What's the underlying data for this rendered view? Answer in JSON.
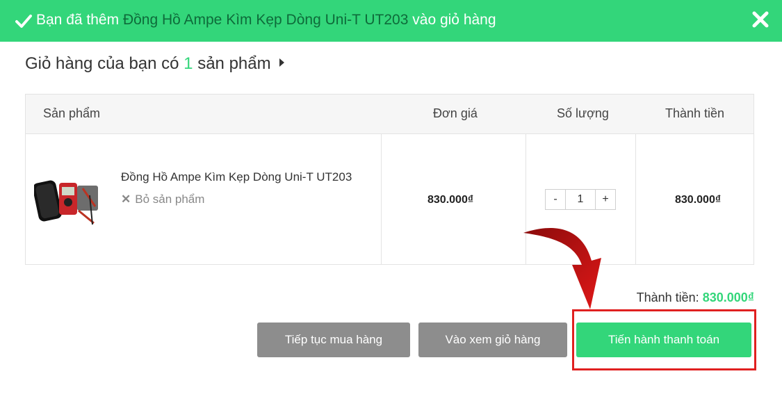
{
  "notification": {
    "prefix": "Bạn đã thêm",
    "product": "Đồng Hồ Ampe Kìm Kẹp Dòng Uni-T UT203",
    "suffix": "vào giỏ hàng"
  },
  "heading": {
    "before": "Giỏ hàng của bạn có",
    "count": "1",
    "after": "sản phẩm"
  },
  "table": {
    "headers": [
      "Sản phẩm",
      "Đơn giá",
      "Số lượng",
      "Thành tiền"
    ],
    "rows": [
      {
        "name": "Đồng Hồ Ampe Kìm Kẹp Dòng Uni-T UT203",
        "remove_label": "Bỏ sản phẩm",
        "unit_price": "830.000₫",
        "quantity": "1",
        "line_total": "830.000₫"
      }
    ]
  },
  "qty_controls": {
    "minus": "-",
    "plus": "+"
  },
  "summary": {
    "label": "Thành tiền:",
    "amount": "830.000₫"
  },
  "buttons": {
    "continue": "Tiếp tục mua hàng",
    "view_cart": "Vào xem giỏ hàng",
    "checkout": "Tiến hành thanh toán"
  },
  "colors": {
    "accent": "#33d67a",
    "secondary_button": "#8d8d8d",
    "highlight": "#e02020"
  },
  "icons": {
    "check": "check-icon",
    "close": "close-icon",
    "remove": "remove-x-icon",
    "caret": "caret-right-icon",
    "arrow": "curved-arrow-icon"
  }
}
